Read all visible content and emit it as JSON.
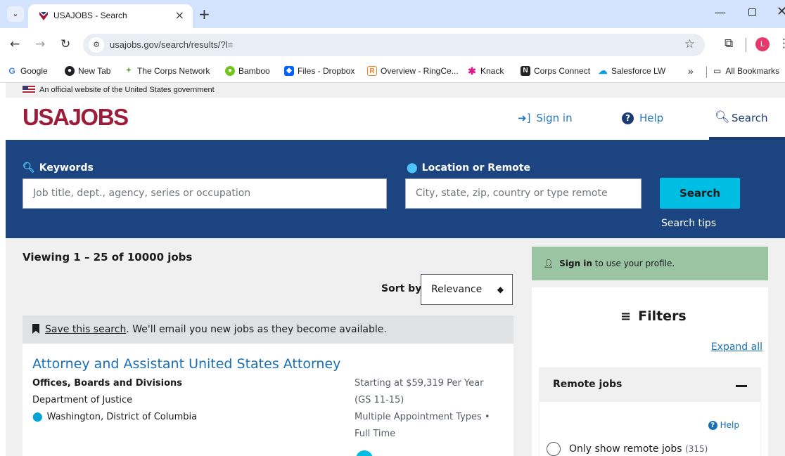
{
  "browser": {
    "tab_title": "USAJOBS - Search",
    "tab_close": "×",
    "new_tab": "+",
    "tab_list": "⌄",
    "url": "usajobs.gov/search/results/?l=",
    "profile_initial": "L",
    "bookmarks": [
      {
        "label": "Google",
        "icon": "G",
        "color": "#4285f4"
      },
      {
        "label": "New Tab",
        "icon": "●",
        "color": "#202124"
      },
      {
        "label": "The Corps Network",
        "icon": "✦",
        "color": "#6aa84f"
      },
      {
        "label": "Bamboo",
        "icon": "●",
        "color": "#73c41d"
      },
      {
        "label": "Files - Dropbox",
        "icon": "◆",
        "color": "#0061fe"
      },
      {
        "label": "Overview - RingCe...",
        "icon": "R",
        "color": "#f58220"
      },
      {
        "label": "Knack",
        "icon": "✱",
        "color": "#d81b8c"
      },
      {
        "label": "Corps Connect",
        "icon": "N",
        "color": "#222"
      },
      {
        "label": "Salesforce LW",
        "icon": "☁",
        "color": "#00a1e0"
      }
    ],
    "bookmarks_more": "»",
    "all_bookmarks": "All Bookmarks"
  },
  "page": {
    "gov_banner": "An official website of the United States government",
    "logo": "USAJOBS",
    "nav": {
      "sign_in": "Sign in",
      "help": "Help",
      "search": "Search"
    },
    "search": {
      "keywords_label": "Keywords",
      "keywords_placeholder": "Job title, dept., agency, series or occupation",
      "location_label": "Location or Remote",
      "location_placeholder": "City, state, zip, country or type remote",
      "button": "Search",
      "tips": "Search tips"
    },
    "results": {
      "viewing": "Viewing 1 – 25 of 10000 jobs",
      "sort_label": "Sort by",
      "sort_value": "Relevance",
      "save_link": "Save this search",
      "save_text": ". We'll email you new jobs as they become available."
    },
    "job": {
      "title": "Attorney and Assistant United States Attorney",
      "org": "Offices, Boards and Divisions",
      "dept": "Department of Justice",
      "location": "Washington, District of Columbia",
      "salary": "Starting at $59,319 Per Year",
      "grade": "(GS 11-15)",
      "appointment": "Multiple Appointment Types •",
      "schedule": "Full Time"
    },
    "sidebar": {
      "signin_bold": "Sign in",
      "signin_text": " to use your profile.",
      "filters_title": "Filters",
      "expand_all": "Expand all",
      "remote_title": "Remote jobs",
      "help": "Help",
      "remote_option": "Only show remote jobs",
      "remote_count": "(315)"
    }
  },
  "colors": {
    "brand_red": "#9c1d3a",
    "hero_blue": "#1b4480",
    "accent_cyan": "#00bde3",
    "signin_green": "#9bc5a2",
    "link_blue": "#1a6fb4"
  }
}
